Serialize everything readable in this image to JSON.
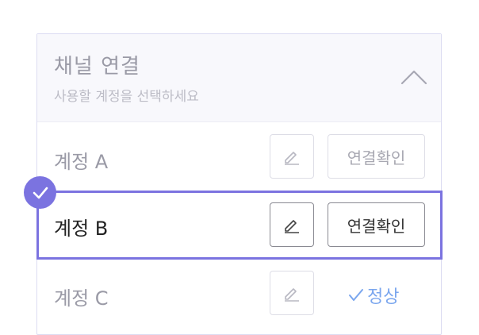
{
  "header": {
    "title": "채널 연결",
    "subtitle": "사용할 계정을 선택하세요",
    "collapse_icon": "chevron-up-icon"
  },
  "accounts": [
    {
      "name": "계정 A",
      "edit_icon": "pencil-icon",
      "action_label": "연결확인",
      "selected": false
    },
    {
      "name": "계정 B",
      "edit_icon": "pencil-icon",
      "action_label": "연결확인",
      "selected": true
    },
    {
      "name": "계정 C",
      "edit_icon": "pencil-icon",
      "status_label": "정상",
      "status_icon": "check-icon",
      "selected": false
    }
  ],
  "colors": {
    "accent": "#7b73e0",
    "status_ok": "#7aa6ee",
    "muted_text": "#9a9aa6",
    "border": "#dcdcf2"
  }
}
